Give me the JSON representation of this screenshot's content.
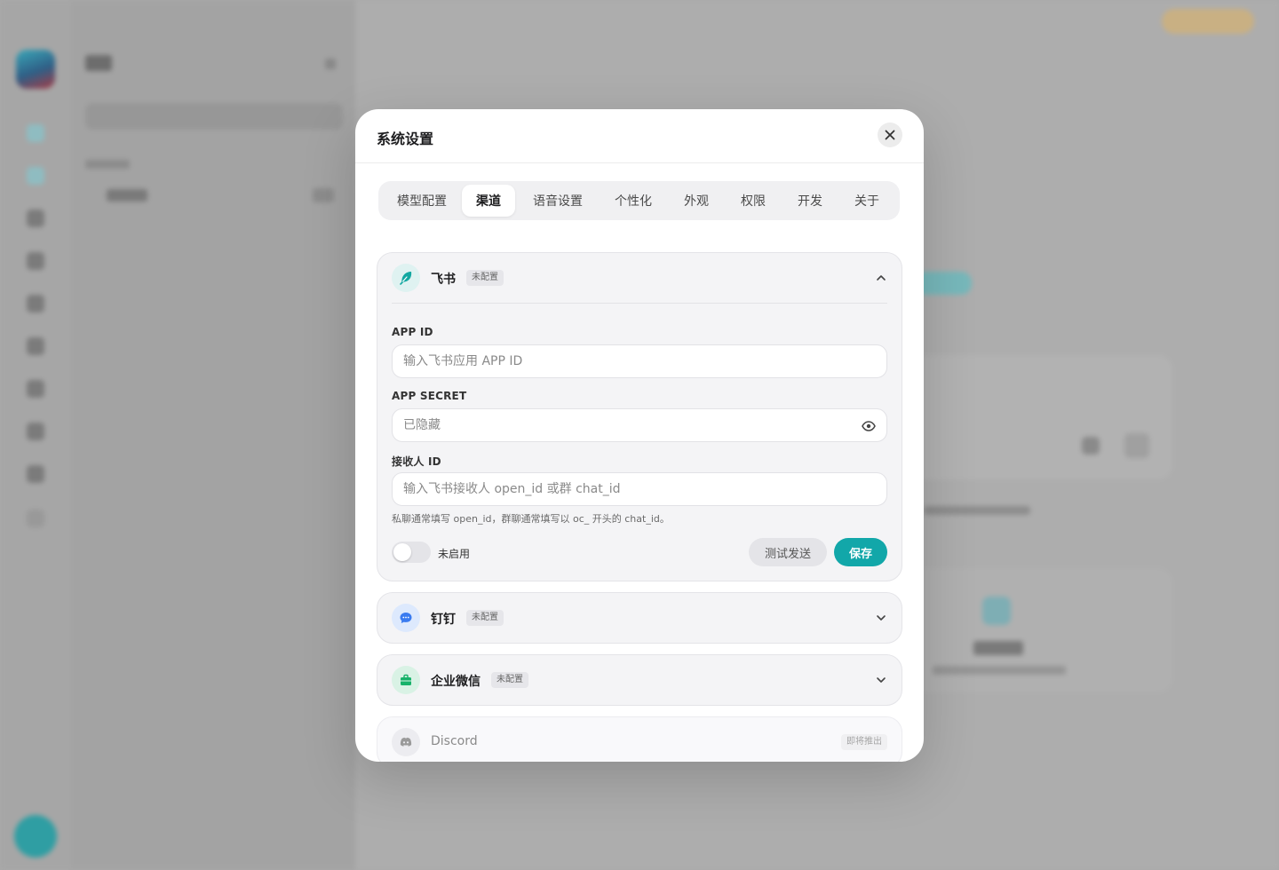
{
  "modal": {
    "title": "系统设置",
    "close_icon": "close-icon"
  },
  "tabs": [
    {
      "label": "模型配置",
      "active": false
    },
    {
      "label": "渠道",
      "active": true
    },
    {
      "label": "语音设置",
      "active": false
    },
    {
      "label": "个性化",
      "active": false
    },
    {
      "label": "外观",
      "active": false
    },
    {
      "label": "权限",
      "active": false
    },
    {
      "label": "开发",
      "active": false
    },
    {
      "label": "关于",
      "active": false
    }
  ],
  "channels": {
    "feishu": {
      "name": "飞书",
      "status": "未配置",
      "icon": "feather-icon",
      "expanded": true,
      "fields": {
        "app_id": {
          "label": "APP ID",
          "placeholder": "输入飞书应用 APP ID",
          "value": ""
        },
        "app_secret": {
          "label": "APP SECRET",
          "placeholder": "已隐藏",
          "value": ""
        },
        "receiver_id": {
          "label": "接收人 ID",
          "placeholder": "输入飞书接收人 open_id 或群 chat_id",
          "value": ""
        }
      },
      "hint": "私聊通常填写 open_id，群聊通常填写以 oc_ 开头的 chat_id。",
      "toggle_label": "未启用",
      "enabled": false,
      "test_button": "测试发送",
      "save_button": "保存"
    },
    "dingtalk": {
      "name": "钉钉",
      "status": "未配置",
      "icon": "chat-bubble-icon"
    },
    "wecom": {
      "name": "企业微信",
      "status": "未配置",
      "icon": "briefcase-icon"
    },
    "discord": {
      "name": "Discord",
      "status": "即将推出",
      "icon": "discord-icon"
    }
  },
  "colors": {
    "accent": "#12a7a9",
    "feishu_icon": "#13a8a1",
    "dingtalk_icon": "#3a7bf0",
    "wecom_icon": "#17b26a",
    "discord_icon": "#9a9a9a"
  }
}
